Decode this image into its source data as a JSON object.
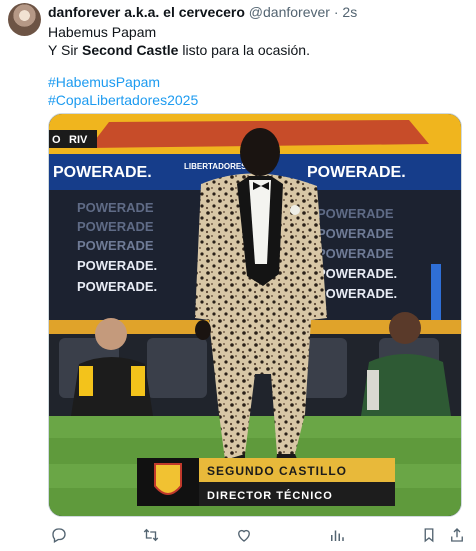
{
  "tweet": {
    "display_name": "danforever a.k.a. el cervecero",
    "handle": "@danforever",
    "separator": "·",
    "time": "2s",
    "line1": "Habemus Papam",
    "line2_prefix": "Y Sir ",
    "line2_bold": "Second Castle",
    "line2_suffix": " listo para la ocasión.",
    "hashtags": [
      "#HabemusPapam",
      "#CopaLibertadores2025"
    ]
  },
  "media": {
    "scoreboard_left": "O",
    "scoreboard_team": "RIV",
    "banner_top": "POWERADE.",
    "banner_libertadores": "LIBERTADORES",
    "board_word": "POWERADE",
    "board_word_dot": "POWERADE.",
    "caption_name": "SEGUNDO CASTILLO",
    "caption_role": "DIRECTOR TÉCNICO"
  },
  "actions": [
    "reply-icon",
    "retweet-icon",
    "like-icon",
    "views-icon",
    "bookmark-icon",
    "share-icon"
  ],
  "colors": {
    "link": "#1d9bf0",
    "muted": "#536471",
    "caption_gold": "#e8b93a"
  }
}
